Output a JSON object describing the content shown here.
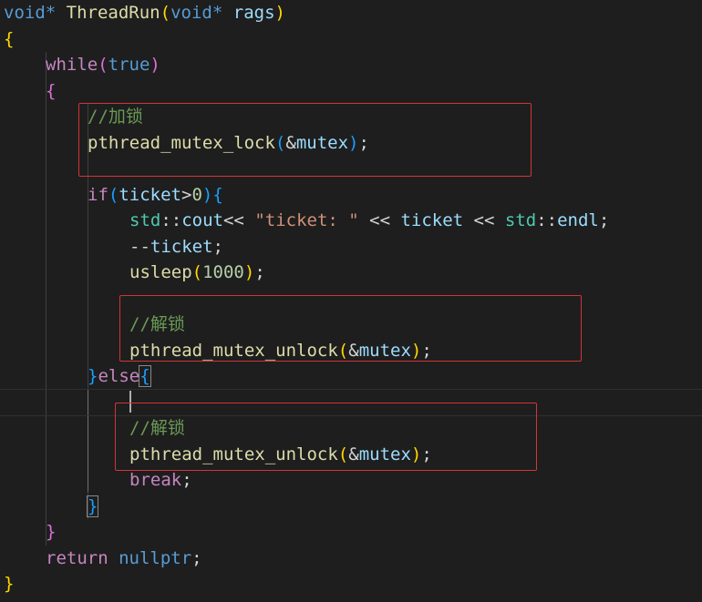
{
  "code": {
    "l1": {
      "t1": "void",
      "t2": "*",
      "t3": " ",
      "t4": "ThreadRun",
      "t5": "(",
      "t6": "void",
      "t7": "*",
      "t8": " ",
      "t9": "rags",
      "t10": ")"
    },
    "l2": {
      "t1": "{"
    },
    "l3": {
      "t1": "while",
      "t2": "(",
      "t3": "true",
      "t4": ")"
    },
    "l4": {
      "t1": "{"
    },
    "l5": {
      "t1": "//加锁"
    },
    "l6": {
      "t1": "pthread_mutex_lock",
      "t2": "(",
      "t3": "&",
      "t4": "mutex",
      "t5": ")",
      "t6": ";"
    },
    "l8": {
      "t1": "if",
      "t2": "(",
      "t3": "ticket",
      "t4": ">",
      "t5": "0",
      "t6": ")",
      "t7": "{"
    },
    "l9": {
      "t1": "std",
      "t2": "::",
      "t3": "cout",
      "t4": "<< ",
      "t5": "\"ticket: \"",
      "t6": " << ",
      "t7": "ticket",
      "t8": " << ",
      "t9": "std",
      "t10": "::",
      "t11": "endl",
      "t12": ";"
    },
    "l10": {
      "t1": "--",
      "t2": "ticket",
      "t3": ";"
    },
    "l11": {
      "t1": "usleep",
      "t2": "(",
      "t3": "1000",
      "t4": ")",
      "t5": ";"
    },
    "l13": {
      "t1": "//解锁"
    },
    "l14": {
      "t1": "pthread_mutex_unlock",
      "t2": "(",
      "t3": "&",
      "t4": "mutex",
      "t5": ")",
      "t6": ";"
    },
    "l15": {
      "t1": "}",
      "t2": "else",
      "t3": "{"
    },
    "l17": {
      "t1": "//解锁"
    },
    "l18": {
      "t1": "pthread_mutex_unlock",
      "t2": "(",
      "t3": "&",
      "t4": "mutex",
      "t5": ")",
      "t6": ";"
    },
    "l19": {
      "t1": "break",
      "t2": ";"
    },
    "l20": {
      "t1": "}"
    },
    "l21": {
      "t1": "}"
    },
    "l22": {
      "t1": "return",
      "t2": " ",
      "t3": "nullptr",
      "t4": ";"
    },
    "l23": {
      "t1": "}"
    }
  },
  "colors": {
    "background": "#1e1e1e",
    "highlight_box": "#d13438",
    "keyword": "#569cd6",
    "control": "#c586c0",
    "function": "#dcdcaa",
    "variable": "#9cdcfe",
    "namespace": "#4ec9b0",
    "string": "#ce9178",
    "number": "#b5cea8",
    "comment": "#6a9955"
  }
}
